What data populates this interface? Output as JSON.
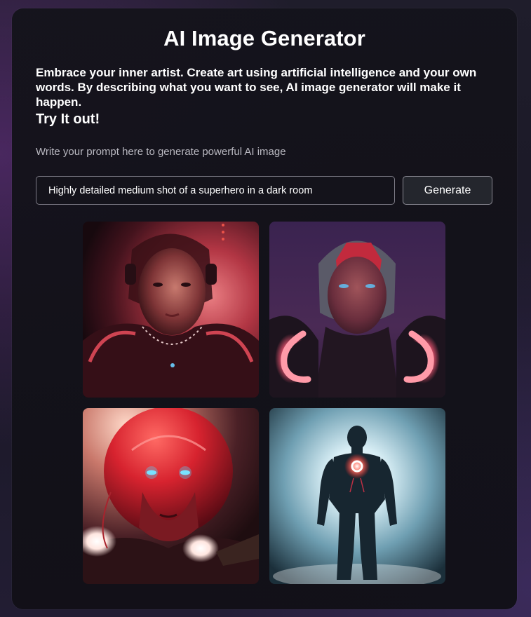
{
  "header": {
    "title": "AI Image Generator"
  },
  "intro": {
    "description": "Embrace your inner artist. Create art using artificial intelligence and your own words. By describing what you want to see, AI image generator will make it happen.",
    "call_to_action": "Try It out!"
  },
  "prompt": {
    "label": "Write your prompt here to generate powerful AI image",
    "value": "Highly detailed medium shot of a superhero in a dark room"
  },
  "actions": {
    "generate_label": "Generate"
  },
  "colors": {
    "accent_red": "#e8324a",
    "accent_pink": "#ff5a78",
    "accent_blue": "#4fd8ff",
    "card_background": "#141319",
    "page_background": "#1c1a27"
  }
}
